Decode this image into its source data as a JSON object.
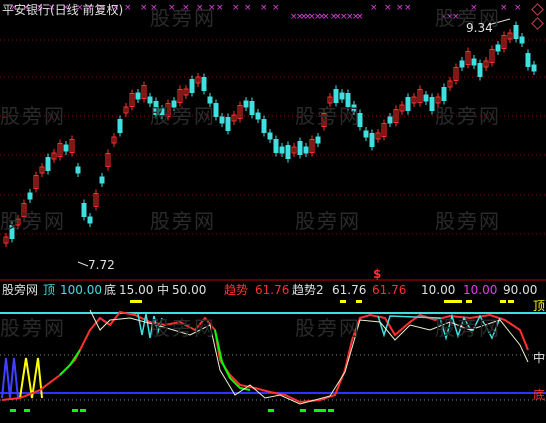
{
  "top_chart": {
    "title": "平安银行(日线 前复权)",
    "high_label": "9.34",
    "low_label": "7.72"
  },
  "indicator": {
    "panel_name": "股旁网",
    "top_label": "顶",
    "top_value": "100.00",
    "bottom_label": "底",
    "bottom_value": "15.00",
    "mid_label": "中",
    "mid_value": "50.00",
    "trend_label": "趋势",
    "trend_value": "61.76",
    "trend2_label": "趋势2",
    "trend2_value": "61.76",
    "trend2_extra": "61.76",
    "t1": "10.00",
    "t2": "10.00",
    "t3": "90.00",
    "side_top": "顶",
    "side_mid": "中",
    "side_bottom": "底",
    "dollar": "$"
  },
  "watermark": "股旁网",
  "colors": {
    "up": "#ff3030",
    "down": "#40e0e0",
    "cyan_line": "#40e0e0",
    "blue_line": "#3030ff",
    "magenta": "#e040e0",
    "yellow": "#ffff00",
    "green": "#00ff00",
    "grid_red": "#a00000"
  }
}
